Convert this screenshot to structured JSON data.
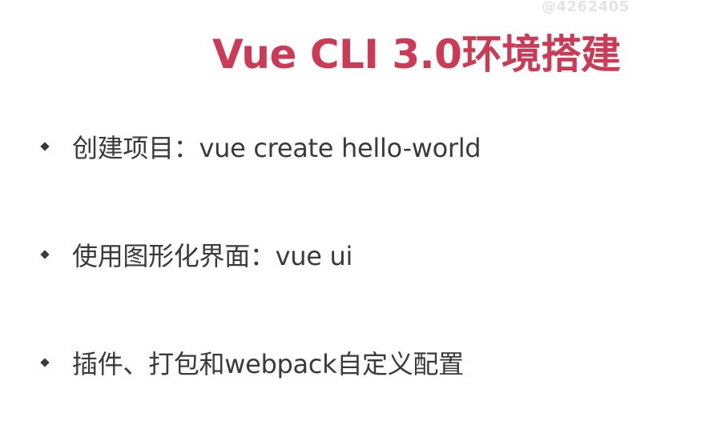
{
  "watermark": "@4262405",
  "title": "Vue CLI 3.0环境搭建",
  "bullets": [
    {
      "text": "创建项目：vue create hello-world"
    },
    {
      "text": "使用图形化界面：vue ui"
    },
    {
      "text": "插件、打包和webpack自定义配置"
    }
  ],
  "colors": {
    "title": "#cc3b55",
    "body_text": "#3a3a3a",
    "background": "#ffffff",
    "watermark": "#e3e3e3"
  }
}
